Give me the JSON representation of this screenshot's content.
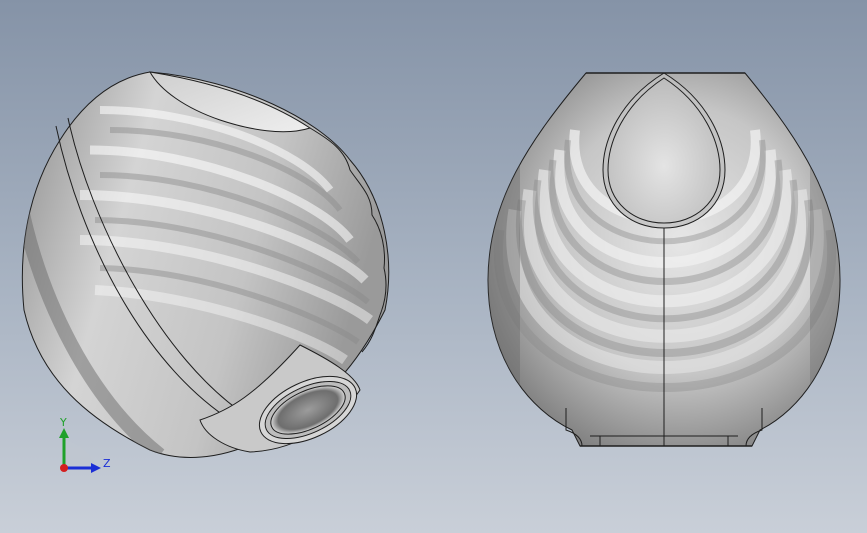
{
  "viewport": {
    "background_top": "#8593a7",
    "background_bottom": "#c9cfd8",
    "model_color": "#d3d3d3",
    "edge_color": "#1e1e1e"
  },
  "models": [
    {
      "name": "ribbed-vase-isometric",
      "view": "isometric"
    },
    {
      "name": "ribbed-vase-front",
      "view": "front"
    }
  ],
  "triad": {
    "y_label": "Y",
    "z_label": "Z",
    "y_color": "#1fa12a",
    "z_color": "#1a2ed6",
    "x_color": "#d31f1f"
  }
}
